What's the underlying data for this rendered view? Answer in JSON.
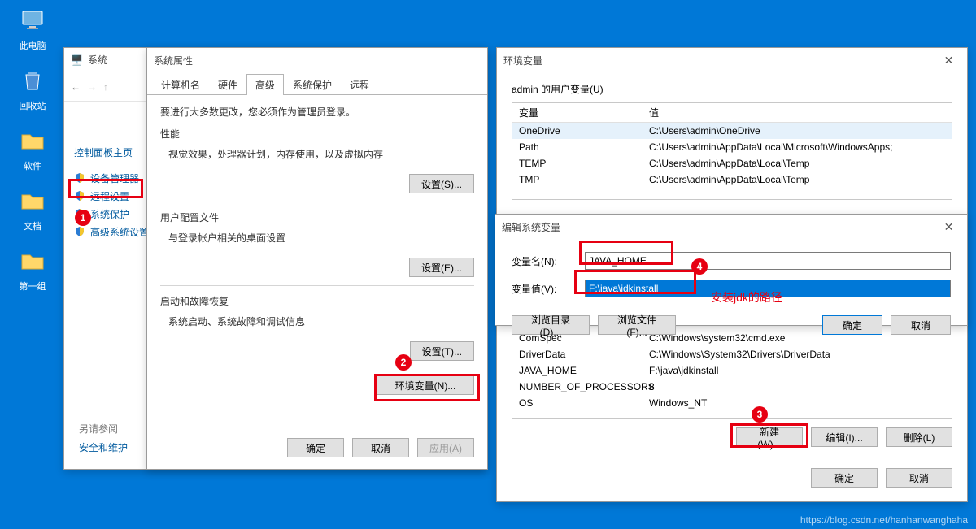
{
  "desktop": {
    "this_pc": "此电脑",
    "recycle": "回收站",
    "software": "软件",
    "docs": "文档",
    "group1": "第一组"
  },
  "sys_window": {
    "title": "系统",
    "nav_back": "←",
    "nav_fwd": "→",
    "cp_home": "控制面板主页",
    "items": [
      "设备管理器",
      "远程设置",
      "系统保护",
      "高级系统设置"
    ],
    "footer_hdr": "另请参阅",
    "footer_link": "安全和维护"
  },
  "prop_window": {
    "title": "系统属性",
    "tabs": [
      "计算机名",
      "硬件",
      "高级",
      "系统保护",
      "远程"
    ],
    "active_tab": 2,
    "admin_note": "要进行大多数更改，您必须作为管理员登录。",
    "perf_t": "性能",
    "perf_d": "视觉效果，处理器计划，内存使用，以及虚拟内存",
    "btn_set_s": "设置(S)...",
    "user_t": "用户配置文件",
    "user_d": "与登录帐户相关的桌面设置",
    "btn_set_e": "设置(E)...",
    "boot_t": "启动和故障恢复",
    "boot_d": "系统启动、系统故障和调试信息",
    "btn_set_t": "设置(T)...",
    "btn_env": "环境变量(N)...",
    "btn_ok": "确定",
    "btn_cancel": "取消",
    "btn_apply": "应用(A)"
  },
  "env_window": {
    "title": "环境变量",
    "user_sec": "admin 的用户变量(U)",
    "col_var": "变量",
    "col_val": "值",
    "user_rows": [
      {
        "v": "OneDrive",
        "val": "C:\\Users\\admin\\OneDrive"
      },
      {
        "v": "Path",
        "val": "C:\\Users\\admin\\AppData\\Local\\Microsoft\\WindowsApps;"
      },
      {
        "v": "TEMP",
        "val": "C:\\Users\\admin\\AppData\\Local\\Temp"
      },
      {
        "v": "TMP",
        "val": "C:\\Users\\admin\\AppData\\Local\\Temp"
      }
    ],
    "sys_rows": [
      {
        "v": "ComSpec",
        "val": "C:\\Windows\\system32\\cmd.exe"
      },
      {
        "v": "DriverData",
        "val": "C:\\Windows\\System32\\Drivers\\DriverData"
      },
      {
        "v": "JAVA_HOME",
        "val": "F:\\java\\jdkinstall"
      },
      {
        "v": "NUMBER_OF_PROCESSORS",
        "val": "8"
      },
      {
        "v": "OS",
        "val": "Windows_NT"
      }
    ],
    "btn_new": "新建(W)...",
    "btn_edit": "编辑(I)...",
    "btn_del": "删除(L)",
    "btn_ok": "确定",
    "btn_cancel": "取消"
  },
  "edit_window": {
    "title": "编辑系统变量",
    "lbl_name": "变量名(N):",
    "lbl_val": "变量值(V):",
    "val_name": "JAVA_HOME",
    "val_val": "F:\\java\\jdkinstall",
    "btn_browse_dir": "浏览目录(D)...",
    "btn_browse_file": "浏览文件(F)...",
    "btn_ok": "确定",
    "btn_cancel": "取消"
  },
  "annotations": {
    "text": "安装jdk的路径"
  },
  "watermark": "https://blog.csdn.net/hanhanwanghaha"
}
